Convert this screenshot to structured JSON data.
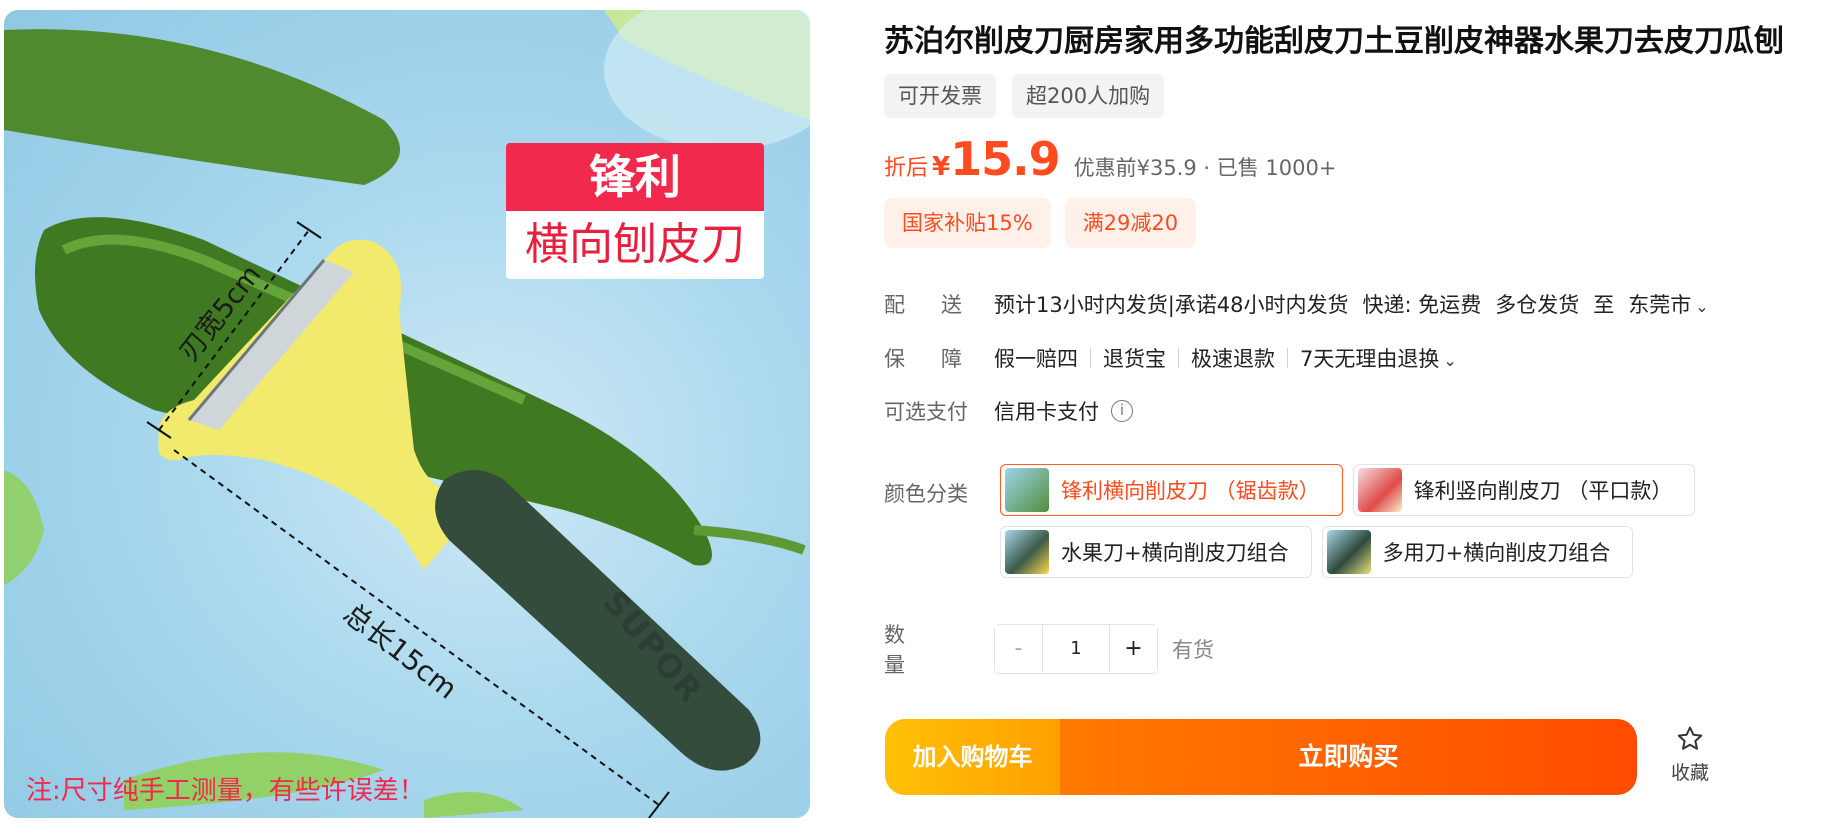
{
  "product": {
    "title": "苏泊尔削皮刀厨房家用多功能刮皮刀土豆削皮神器水果刀去皮刀瓜刨",
    "tags": [
      "可开发票",
      "超200人加购"
    ],
    "image": {
      "badge_top": "锋利",
      "badge_bottom": "横向刨皮刀",
      "blade_label": "刃宽5cm",
      "length_label": "总长15cm",
      "brand_mark": "SUPOR",
      "note": "注:尺寸纯手工测量，有些许误差！"
    }
  },
  "price": {
    "prefix": "折后",
    "currency": "¥",
    "value": "15.9",
    "meta": "优惠前¥35.9 · 已售 1000+"
  },
  "promos": [
    "国家补贴15%",
    "满29减20"
  ],
  "delivery": {
    "label": "配送",
    "items": [
      "预计13小时内发货|承诺48小时内发货",
      "快递: 免运费",
      "多仓发货",
      "至",
      "东莞市"
    ]
  },
  "guarantee": {
    "label": "保障",
    "items": [
      "假一赔四",
      "退货宝",
      "极速退款",
      "7天无理由退换"
    ]
  },
  "payment": {
    "label": "可选支付",
    "value": "信用卡支付",
    "icon": "info-icon"
  },
  "color": {
    "label": "颜色分类",
    "options": [
      {
        "label": "锋利横向削皮刀 （锯齿款）",
        "selected": true
      },
      {
        "label": "锋利竖向削皮刀 （平口款）",
        "selected": false
      },
      {
        "label": "水果刀+横向削皮刀组合",
        "selected": false
      },
      {
        "label": "多用刀+横向削皮刀组合",
        "selected": false
      }
    ]
  },
  "quantity": {
    "label": "数量",
    "minus": "-",
    "value": "1",
    "plus": "+",
    "stock": "有货"
  },
  "actions": {
    "add_to_cart": "加入购物车",
    "buy_now": "立即购买",
    "favorite": "收藏",
    "favorite_icon": "star-icon"
  },
  "colors": {
    "accent": "#ff4b1f",
    "badge_red": "#f0294d",
    "cart_yellow": "#ffb300",
    "buy_orange": "#ff6a00"
  }
}
